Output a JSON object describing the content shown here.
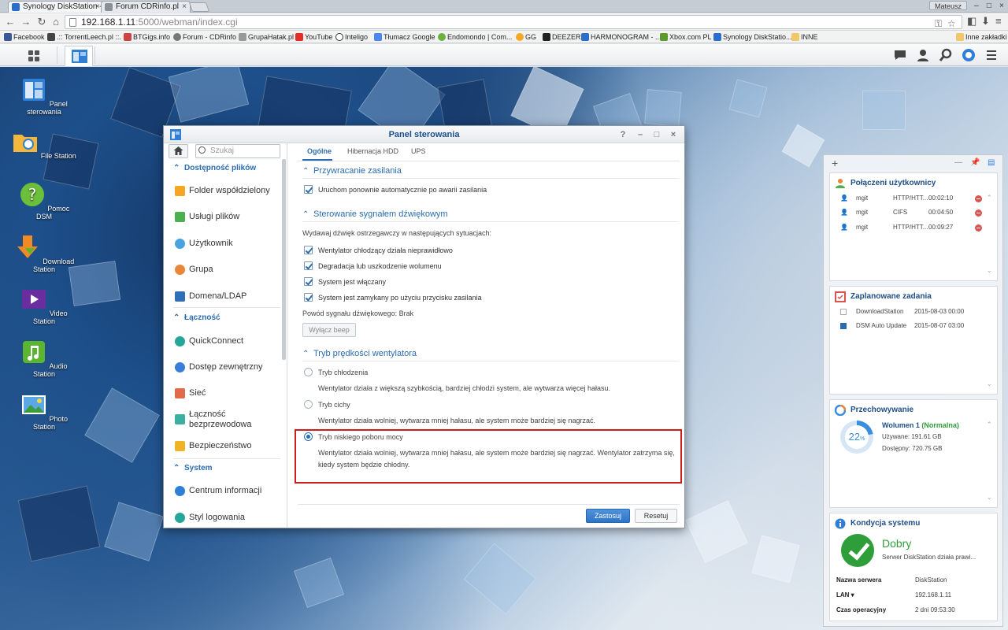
{
  "browser": {
    "tabs": [
      {
        "title": "Synology DiskStation - Di",
        "close": "×"
      },
      {
        "title": "Forum CDRinfo.pl",
        "close": "×"
      }
    ],
    "user_badge": "Mateusz",
    "window_controls": [
      "–",
      "□",
      "×"
    ],
    "url_host": "192.168.1.11",
    "url_path": ":5000/webman/index.cgi",
    "bookmarks": [
      "Facebook",
      ".:: TorrentLeech.pl ::.",
      "BTGigs.info",
      "Forum - CDRinfo",
      "GrupaHatak.pl",
      "YouTube",
      "Inteligo",
      "Tłumacz Google",
      "Endomondo | Com...",
      "GG",
      "DEEZER",
      "HARMONOGRAM - ...",
      "Xbox.com PL",
      "Synology DiskStatio...",
      "INNE"
    ],
    "other_bookmarks": "Inne zakładki"
  },
  "desktop_icons": [
    "Panel sterowania",
    "File Station",
    "Pomoc DSM",
    "Download Station",
    "Video Station",
    "Audio Station",
    "Photo Station"
  ],
  "control_panel": {
    "title": "Panel sterowania",
    "search_placeholder": "Szukaj",
    "sidebar": {
      "group1": "Dostępność plików",
      "items1": [
        "Folder współdzielony",
        "Usługi plików",
        "Użytkownik",
        "Grupa",
        "Domena/LDAP"
      ],
      "group2": "Łączność",
      "items2": [
        "QuickConnect",
        "Dostęp zewnętrzny",
        "Sieć",
        "Łączność bezprzewodowa",
        "Bezpieczeństwo"
      ],
      "group3": "System",
      "items3": [
        "Centrum informacji",
        "Styl logowania"
      ]
    },
    "tabs": [
      "Ogólne",
      "Hibernacja HDD",
      "UPS"
    ],
    "sections": {
      "power": {
        "title": "Przywracanie zasilania",
        "option": "Uruchom ponownie automatycznie po awarii zasilania"
      },
      "beep": {
        "title": "Sterowanie sygnałem dźwiękowym",
        "intro": "Wydawaj dźwięk ostrzegawczy w następujących sytuacjach:",
        "options": [
          "Wentylator chłodzący działa nieprawidłowo",
          "Degradacja lub uszkodzenie wolumenu",
          "System jest włączany",
          "System jest zamykany po użyciu przycisku zasilania"
        ],
        "reason": "Powód sygnału dźwiękowego: Brak",
        "button": "Wyłącz beep"
      },
      "fan": {
        "title": "Tryb prędkości wentylatora",
        "modes": [
          {
            "label": "Tryb chłodzenia",
            "desc": "Wentylator działa z większą szybkością, bardziej chłodzi system, ale wytwarza więcej hałasu."
          },
          {
            "label": "Tryb cichy",
            "desc": "Wentylator działa wolniej, wytwarza mniej hałasu, ale system może bardziej się nagrzać."
          },
          {
            "label": "Tryb niskiego poboru mocy",
            "desc": "Wentylator działa wolniej, wytwarza mniej hałasu, ale system może bardziej się nagrzać. Wentylator zatrzyma się, kiedy system będzie chłodny."
          }
        ]
      }
    },
    "apply": "Zastosuj",
    "reset": "Resetuj"
  },
  "widgets": {
    "connected": {
      "title": "Połączeni użytkownicy",
      "rows": [
        {
          "user": "mgit",
          "proto": "HTTP/HTT...",
          "time": "00:02:10"
        },
        {
          "user": "mgit",
          "proto": "CIFS",
          "time": "00:04:50"
        },
        {
          "user": "mgit",
          "proto": "HTTP/HTT...",
          "time": "00:09:27"
        }
      ]
    },
    "scheduled": {
      "title": "Zaplanowane zadania",
      "rows": [
        {
          "name": "DownloadStation",
          "date": "2015-08-03 00:00"
        },
        {
          "name": "DSM Auto Update",
          "date": "2015-08-07 03:00"
        }
      ]
    },
    "storage": {
      "title": "Przechowywanie",
      "percent": "22",
      "percent_unit": "%",
      "volume": "Wolumen 1",
      "status": "(Normalna)",
      "used": "Używane: 191.61 GB",
      "free": "Dostępny: 720.75 GB"
    },
    "health": {
      "title": "Kondycja systemu",
      "status": "Dobry",
      "desc": "Serwer DiskStation działa prawi...",
      "server_label": "Nazwa serwera",
      "server_value": "DiskStation",
      "lan_label": "LAN ▾",
      "lan_value": "192.168.1.11",
      "uptime_label": "Czas operacyjny",
      "uptime_value": "2 dni 09:53:30"
    }
  },
  "colors": {
    "accent": "#2b6cb0",
    "highlight": "#d01c1c",
    "ok": "#2e9e3a"
  }
}
